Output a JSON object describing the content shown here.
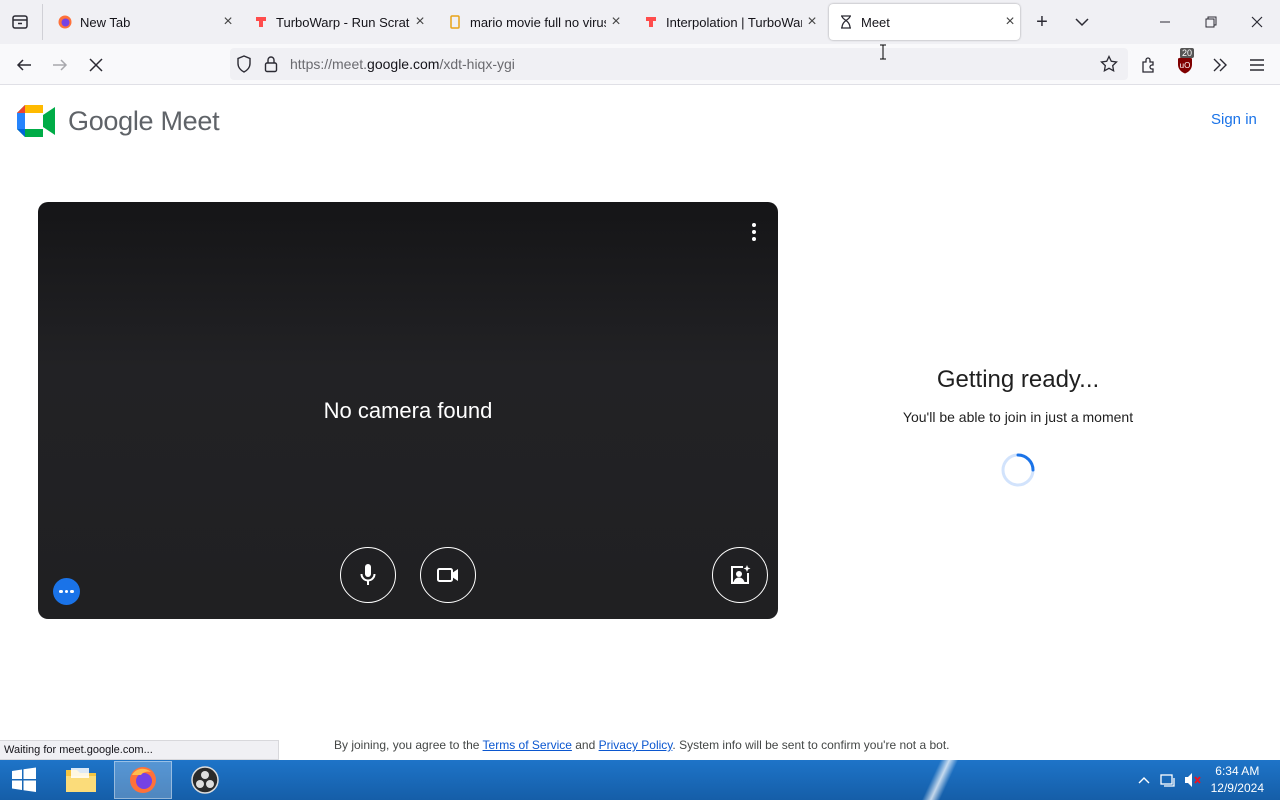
{
  "browser": {
    "tabs": [
      {
        "title": "New Tab",
        "icon": "firefox-icon"
      },
      {
        "title": "TurboWarp - Run Scratch",
        "icon": "turbowarp-icon"
      },
      {
        "title": "mario movie full no virus",
        "icon": "doc-icon"
      },
      {
        "title": "Interpolation | TurboWarp",
        "icon": "turbowarp-icon"
      },
      {
        "title": "Meet",
        "icon": "hourglass-icon",
        "active": true
      }
    ],
    "url_prefix": "https://meet.",
    "url_domain": "google.com",
    "url_path": "/xdt-hiqx-ygi",
    "extension_badge": "20"
  },
  "page": {
    "logo_text": "Google Meet",
    "sign_in": "Sign in",
    "preview": {
      "no_camera": "No camera found"
    },
    "status_title": "Getting ready...",
    "status_message": "You'll be able to join in just a moment",
    "terms": {
      "prefix": "By joining, you agree to the ",
      "tos": "Terms of Service",
      "and": " and ",
      "privacy": "Privacy Policy",
      "suffix": ". System info will be sent to confirm you're not a bot."
    }
  },
  "statusbar": {
    "text": "Waiting for meet.google.com..."
  },
  "taskbar": {
    "time": "6:34 AM",
    "date": "12/9/2024"
  },
  "colors": {
    "accent": "#1a73e8",
    "taskbar": "#1e74c8"
  }
}
